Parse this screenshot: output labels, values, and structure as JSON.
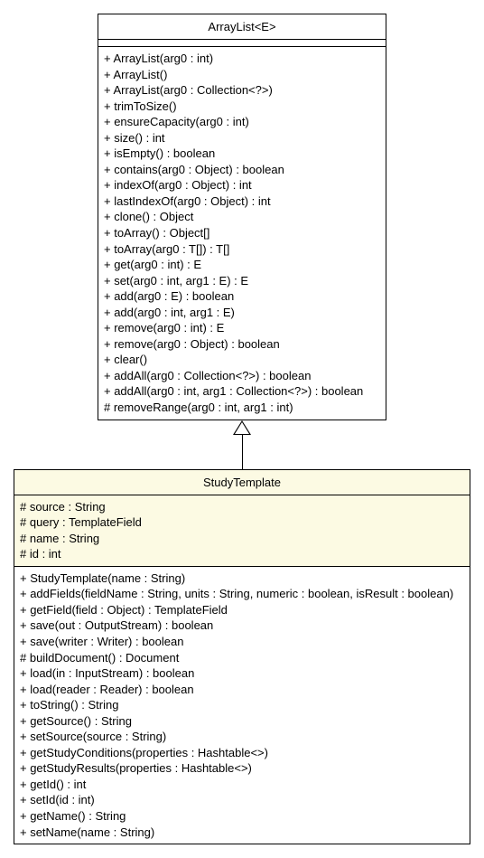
{
  "parent": {
    "title": "ArrayList<E>",
    "members": [
      "+ ArrayList(arg0 : int)",
      "+ ArrayList()",
      "+ ArrayList(arg0 : Collection<?>)",
      "+ trimToSize()",
      "+ ensureCapacity(arg0 : int)",
      "+ size() : int",
      "+ isEmpty() : boolean",
      "+ contains(arg0 : Object) : boolean",
      "+ indexOf(arg0 : Object) : int",
      "+ lastIndexOf(arg0 : Object) : int",
      "+ clone() : Object",
      "+ toArray() : Object[]",
      "+ toArray(arg0 : T[]) : T[]",
      "+ get(arg0 : int) : E",
      "+ set(arg0 : int, arg1 : E) : E",
      "+ add(arg0 : E) : boolean",
      "+ add(arg0 : int, arg1 : E)",
      "+ remove(arg0 : int) : E",
      "+ remove(arg0 : Object) : boolean",
      "+ clear()",
      "+ addAll(arg0 : Collection<?>) : boolean",
      "+ addAll(arg0 : int, arg1 : Collection<?>) : boolean",
      "# removeRange(arg0 : int, arg1 : int)"
    ]
  },
  "child": {
    "title": "StudyTemplate",
    "attrs": [
      "# source : String",
      "# query : TemplateField",
      "# name : String",
      "# id : int"
    ],
    "members": [
      "+ StudyTemplate(name : String)",
      "+ addFields(fieldName : String, units : String, numeric : boolean, isResult : boolean)",
      "+ getField(field : Object) : TemplateField",
      "+ save(out : OutputStream) : boolean",
      "+ save(writer : Writer) : boolean",
      "# buildDocument() : Document",
      "+ load(in : InputStream) : boolean",
      "+ load(reader : Reader) : boolean",
      "+ toString() : String",
      "+ getSource() : String",
      "+ setSource(source : String)",
      "+ getStudyConditions(properties : Hashtable<>)",
      "+ getStudyResults(properties : Hashtable<>)",
      "+ getId() : int",
      "+ setId(id : int)",
      "+ getName() : String",
      "+ setName(name : String)"
    ]
  }
}
